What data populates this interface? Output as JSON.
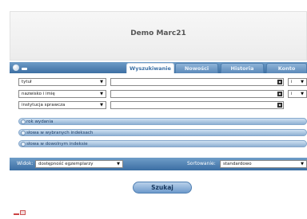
{
  "header": {
    "title": "Demo Marc21"
  },
  "tabs": [
    {
      "label": "Wyszukiwanie",
      "active": true
    },
    {
      "label": "Nowości",
      "active": false
    },
    {
      "label": "Historia",
      "active": false
    },
    {
      "label": "Konto",
      "active": false
    }
  ],
  "search_rows": [
    {
      "field": "tytuł",
      "value": "",
      "operator": "i"
    },
    {
      "field": "nazwisko i imię",
      "value": "",
      "operator": "i"
    },
    {
      "field": "instytucja sprawcza",
      "value": "",
      "operator": ""
    }
  ],
  "expanders": [
    {
      "label": "rok wydania"
    },
    {
      "label": "słowa w wybranych indeksach"
    },
    {
      "label": "słowa w dowolnym indeksie"
    }
  ],
  "sort_bar": {
    "view_label": "Widok:",
    "view_value": "dostępność egzemplarzy",
    "sort_label": "Sortowanie:",
    "sort_value": "standardowo"
  },
  "search_button": {
    "label": "Szukaj"
  },
  "colors": {
    "accent": "#3b6ea3",
    "tab_active_text": "#3a6fa5",
    "button": "#6d9acb"
  }
}
